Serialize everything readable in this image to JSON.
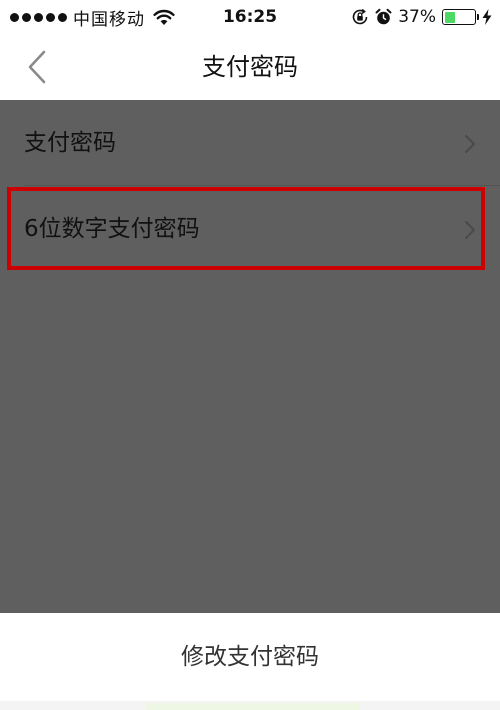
{
  "status_bar": {
    "carrier": "中国移动",
    "time": "16:25",
    "battery_percent": "37%",
    "battery_level": 0.37,
    "icons": [
      "signal-dots-icon",
      "wifi-icon",
      "rotation-lock-icon",
      "alarm-icon",
      "battery-icon",
      "charging-bolt-icon"
    ]
  },
  "nav": {
    "title": "支付密码",
    "back_icon": "chevron-left-icon"
  },
  "list": {
    "items": [
      {
        "label": "支付密码"
      },
      {
        "label": "6位数字支付密码"
      }
    ]
  },
  "highlight_color": "#cc0000",
  "action_sheet": {
    "button_label": "修改支付密码"
  },
  "colors": {
    "overlay": "#5f5f5f",
    "battery_green": "#4cd964"
  }
}
